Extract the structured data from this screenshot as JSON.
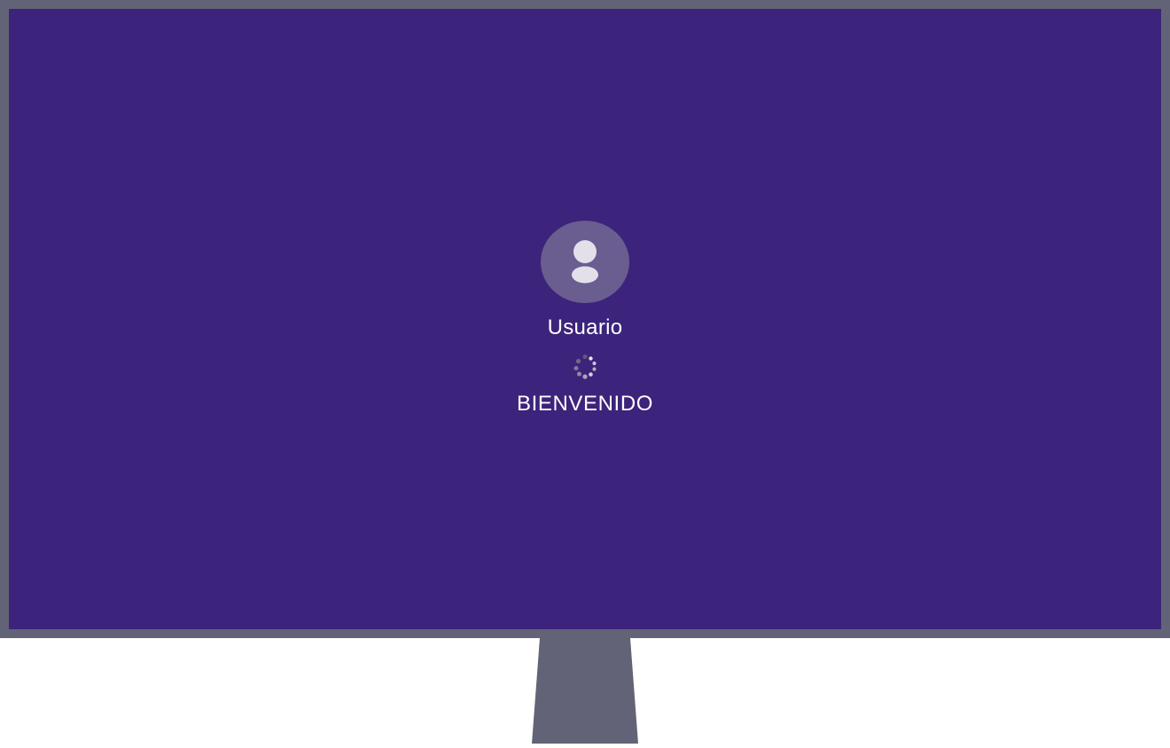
{
  "login": {
    "username": "Usuario",
    "status_text": "BIENVENIDO"
  },
  "icons": {
    "avatar": "user-silhouette-icon",
    "loading": "loading-spinner-icon"
  },
  "colors": {
    "monitor_frame": "#626376",
    "screen_background": "#3c237b",
    "avatar_circle": "#6a5d90",
    "text": "#ffffff"
  }
}
